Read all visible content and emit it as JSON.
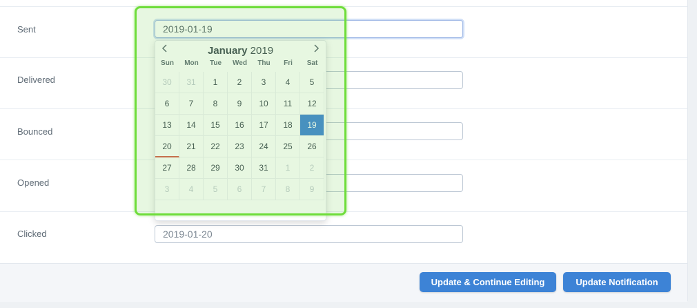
{
  "rows": [
    {
      "label": "Sent",
      "value": "2019-01-19"
    },
    {
      "label": "Delivered",
      "value": ""
    },
    {
      "label": "Bounced",
      "value": ""
    },
    {
      "label": "Opened",
      "value": ""
    },
    {
      "label": "Clicked",
      "value": "2019-01-20"
    }
  ],
  "picker": {
    "month": "January",
    "year": "2019",
    "prev_icon": "chevron-left-icon",
    "next_icon": "chevron-right-icon",
    "weekdays": [
      "Sun",
      "Mon",
      "Tue",
      "Wed",
      "Thu",
      "Fri",
      "Sat"
    ],
    "weeks": [
      [
        "30",
        "31",
        "1",
        "2",
        "3",
        "4",
        "5"
      ],
      [
        "6",
        "7",
        "8",
        "9",
        "10",
        "11",
        "12"
      ],
      [
        "13",
        "14",
        "15",
        "16",
        "17",
        "18",
        "19"
      ],
      [
        "20",
        "21",
        "22",
        "23",
        "24",
        "25",
        "26"
      ],
      [
        "27",
        "28",
        "29",
        "30",
        "31",
        "1",
        "2"
      ],
      [
        "3",
        "4",
        "5",
        "6",
        "7",
        "8",
        "9"
      ]
    ],
    "selected": "19",
    "today": "20"
  },
  "buttons": {
    "update_continue": "Update & Continue Editing",
    "update": "Update Notification"
  },
  "colors": {
    "accent": "#3d83d6",
    "highlight_border": "#6fdd3b",
    "today_marker": "#d65a4a"
  }
}
